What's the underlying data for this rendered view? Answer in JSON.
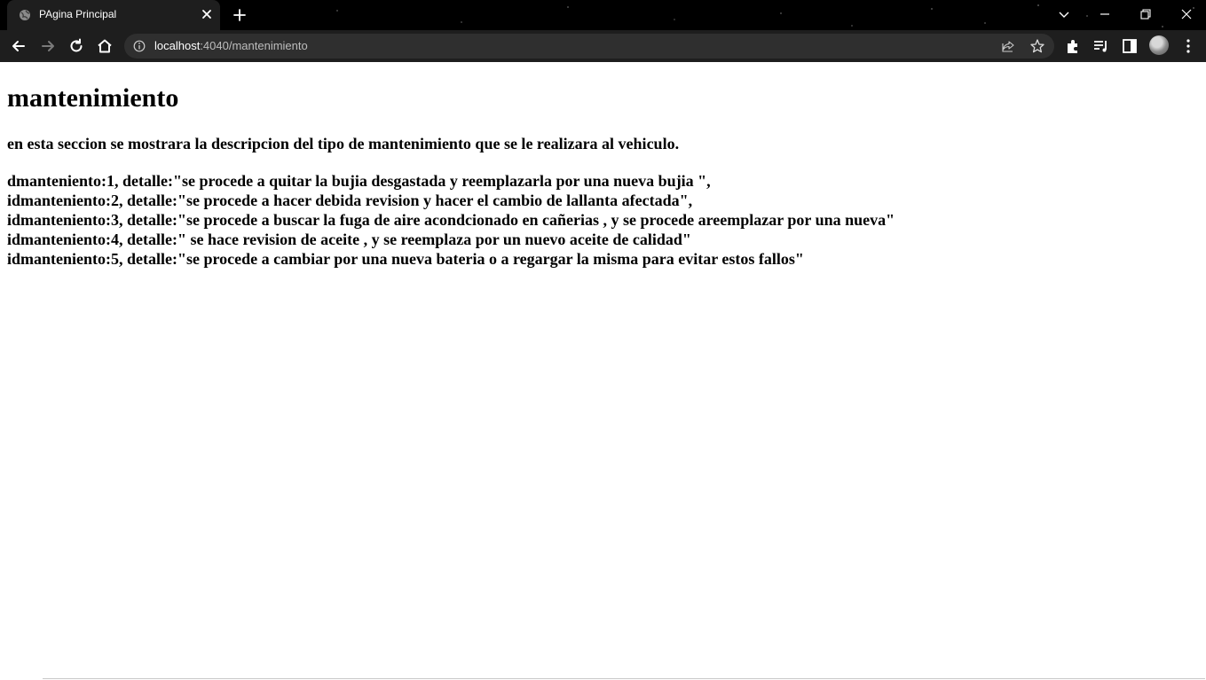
{
  "browser": {
    "tab": {
      "title": "PAgina Principal",
      "favicon": "globe-icon"
    },
    "nav": {
      "back": "back-arrow-icon",
      "forward": "forward-arrow-icon",
      "reload": "reload-icon",
      "home": "home-icon"
    },
    "address_bar": {
      "host": "localhost",
      "path": ":4040/mantenimiento"
    }
  },
  "page": {
    "title": "mantenimiento",
    "description": "en esta seccion se mostrara la descripcion del tipo de mantenimiento que se le realizara al vehiculo.",
    "records": [
      "dmanteniento:1, detalle:\"se procede a quitar la bujia desgastada y reemplazarla por una nueva bujia \",",
      "idmanteniento:2, detalle:\"se procede a hacer debida revision y hacer el cambio de lallanta afectada\",",
      "idmanteniento:3, detalle:\"se procede a buscar la fuga de aire acondcionado en cañerias , y se procede areemplazar por una nueva\"",
      "idmanteniento:4, detalle:\" se hace revision de aceite , y se reemplaza por un nuevo aceite de calidad\"",
      "idmanteniento:5, detalle:\"se procede a cambiar por una nueva bateria o a regargar la misma para evitar estos fallos\""
    ]
  },
  "colors": {
    "chrome_bg": "#000000",
    "toolbar_bg": "#1e1e1e",
    "omnibox_bg": "#2f2f2f",
    "page_bg": "#ffffff",
    "text": "#000000"
  }
}
